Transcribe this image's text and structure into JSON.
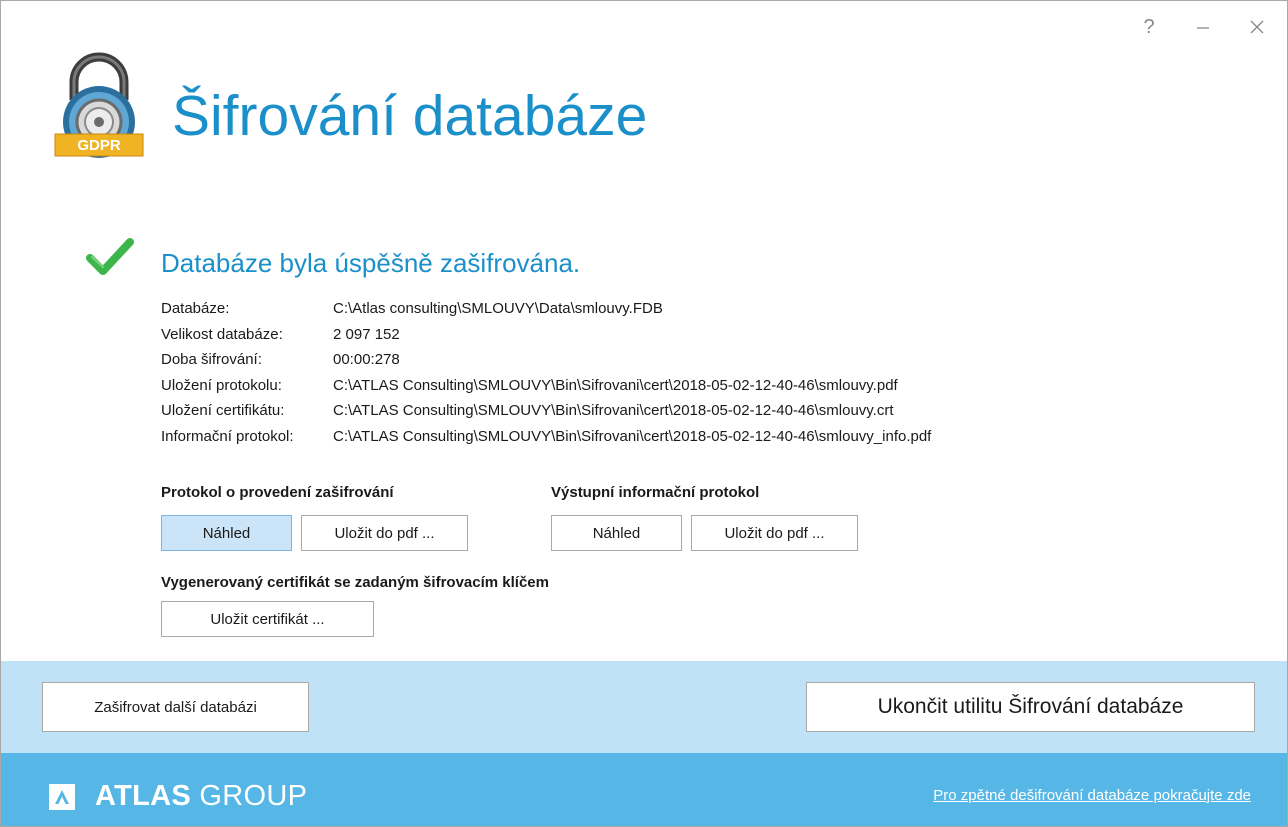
{
  "window": {
    "help_glyph": "?",
    "minimize_glyph": "–",
    "close_glyph": "✕"
  },
  "header": {
    "logo_badge": "GDPR",
    "title": "Šifrování databáze"
  },
  "status": {
    "message": "Databáze byla úspěšně zašifrována.",
    "icon": "checkmark-icon",
    "color": "#3cb64a"
  },
  "info": [
    {
      "label": "Databáze:",
      "value": "C:\\Atlas consulting\\SMLOUVY\\Data\\smlouvy.FDB"
    },
    {
      "label": "Velikost databáze:",
      "value": "2 097 152"
    },
    {
      "label": "Doba šifrování:",
      "value": "00:00:278"
    },
    {
      "label": "Uložení protokolu:",
      "value": "C:\\ATLAS Consulting\\SMLOUVY\\Bin\\Sifrovani\\cert\\2018-05-02-12-40-46\\smlouvy.pdf"
    },
    {
      "label": "Uložení certifikátu:",
      "value": "C:\\ATLAS Consulting\\SMLOUVY\\Bin\\Sifrovani\\cert\\2018-05-02-12-40-46\\smlouvy.crt"
    },
    {
      "label": "Informační protokol:",
      "value": "C:\\ATLAS Consulting\\SMLOUVY\\Bin\\Sifrovani\\cert\\2018-05-02-12-40-46\\smlouvy_info.pdf"
    }
  ],
  "protocol_section": {
    "heading": "Protokol o provedení zašifrování",
    "preview_label": "Náhled",
    "save_pdf_label": "Uložit do pdf ..."
  },
  "info_protocol_section": {
    "heading": "Výstupní informační protokol",
    "preview_label": "Náhled",
    "save_pdf_label": "Uložit do pdf ..."
  },
  "certificate_section": {
    "heading": "Vygenerovaný certifikát se zadaným šifrovacím klíčem",
    "save_label": "Uložit certifikát ..."
  },
  "actions": {
    "encrypt_another_label": "Zašifrovat další databázi",
    "exit_label": "Ukončit utilitu Šifrování databáze"
  },
  "footer": {
    "brand_mark": "A",
    "brand_bold": "ATLAS",
    "brand_regular": " GROUP",
    "decrypt_link": "Pro zpětné dešifrování databáze pokračujte zde"
  },
  "colors": {
    "accent": "#1b8fc9",
    "action_bar": "#bfe2f6",
    "footer": "#56b7e6",
    "focused_button": "#cce4f7"
  }
}
